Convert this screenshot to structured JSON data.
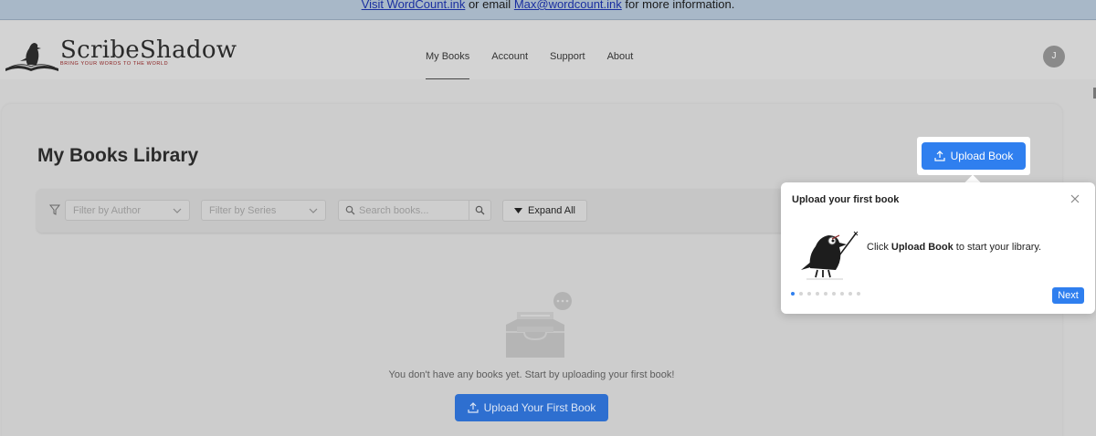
{
  "banner": {
    "link1": "Visit WordCount.ink",
    "middle": " or email ",
    "link2": "Max@wordcount.ink",
    "suffix": " for more information."
  },
  "brand": {
    "name": "ScribeShadow",
    "tagline": "Bring your words to the world"
  },
  "nav": {
    "items": [
      {
        "label": "My Books",
        "active": true
      },
      {
        "label": "Account"
      },
      {
        "label": "Support"
      },
      {
        "label": "About"
      }
    ]
  },
  "user": {
    "initial": "J"
  },
  "page": {
    "title": "My Books Library",
    "upload_label": "Upload Book"
  },
  "filters": {
    "author_placeholder": "Filter by Author",
    "series_placeholder": "Filter by Series",
    "search_placeholder": "Search books...",
    "expand_label": "Expand All"
  },
  "empty_state": {
    "message": "You don't have any books yet. Start by uploading your first book!",
    "button_label": "Upload Your First Book"
  },
  "tour": {
    "title": "Upload your first book",
    "body_prefix": "Click ",
    "body_bold": "Upload Book",
    "body_suffix": " to start your library.",
    "step_count": 9,
    "current_step": 1,
    "next_label": "Next"
  },
  "colors": {
    "accent": "#2f7fef",
    "overlay_bg": "#cfcfcf"
  }
}
